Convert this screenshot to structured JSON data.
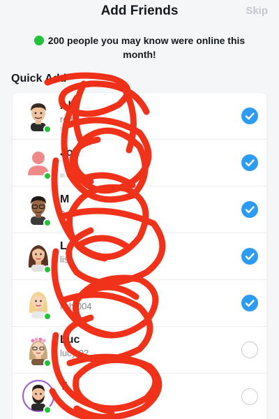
{
  "header": {
    "title": "Add Friends",
    "skip_label": "Skip"
  },
  "banner": {
    "text": "200 people you may know were online this month!"
  },
  "quick_add": {
    "title": "Quick Add",
    "rows": [
      {
        "name": "Al",
        "username": "rom",
        "sub": "In",
        "avatar": "man-dark-hair",
        "selected": true
      },
      {
        "name": "Jo",
        "username": "",
        "sub": "In",
        "avatar": "default-silhouette",
        "selected": true
      },
      {
        "name": "M",
        "username": "b",
        "sub": "I",
        "avatar": "man-glasses",
        "selected": true
      },
      {
        "name": "L",
        "username": "lis",
        "sub": "",
        "avatar": "woman-brown-hair",
        "selected": true
      },
      {
        "name": "",
        "username": "fish 004",
        "sub": "",
        "avatar": "woman-blonde",
        "selected": true
      },
      {
        "name": "Luc",
        "username": "lucy 02",
        "sub": "",
        "avatar": "woman-flower-crown",
        "selected": false
      },
      {
        "name": "T",
        "username": "",
        "sub": "",
        "avatar": "man-beard-ring",
        "selected": false
      }
    ]
  },
  "colors": {
    "accent": "#2b9cf2",
    "online": "#22c33a",
    "scribble": "#f02a12"
  }
}
